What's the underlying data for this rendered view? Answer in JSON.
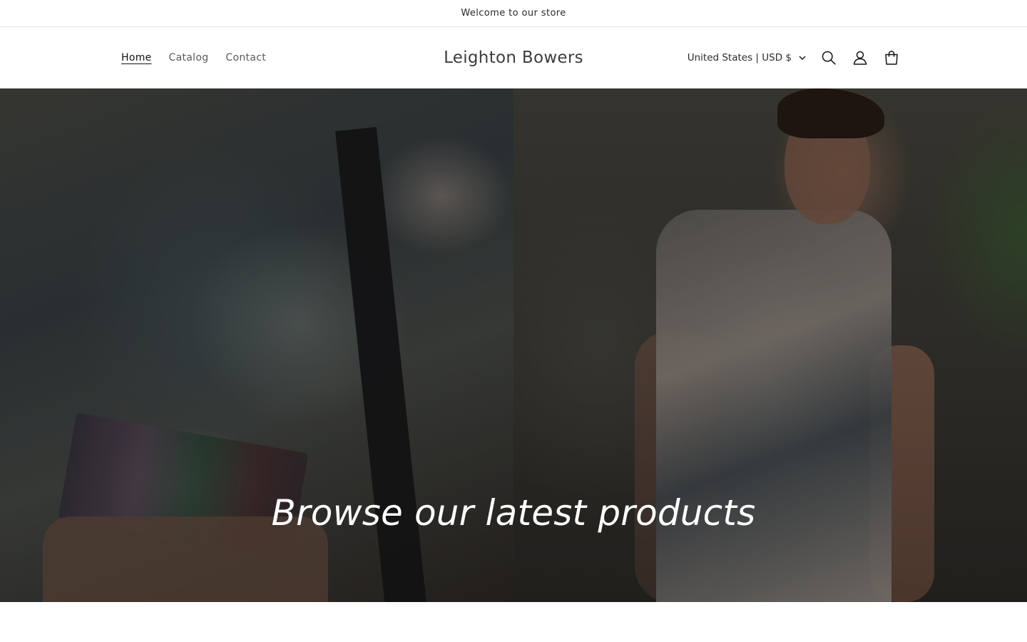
{
  "announcement": {
    "text": "Welcome to our store"
  },
  "header": {
    "brand": "Leighton Bowers",
    "nav": [
      {
        "label": "Home",
        "active": true
      },
      {
        "label": "Catalog",
        "active": false
      },
      {
        "label": "Contact",
        "active": false
      }
    ],
    "locale": "United States | USD $",
    "icons": [
      "search-icon",
      "account-icon",
      "cart-icon",
      "chevron-down-icon"
    ]
  },
  "hero": {
    "heading": "Browse our latest products"
  }
}
